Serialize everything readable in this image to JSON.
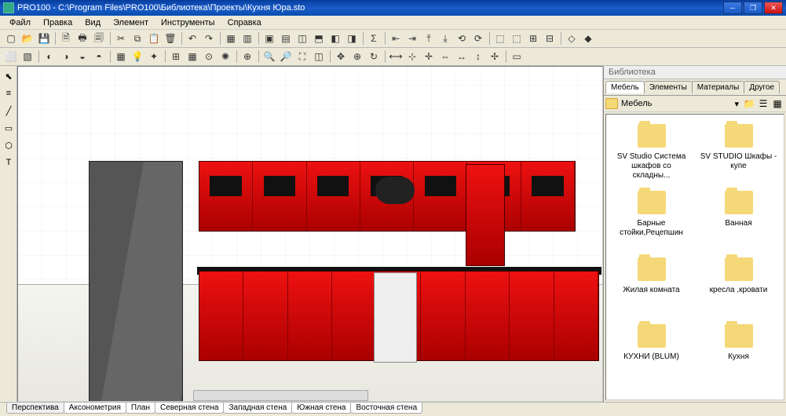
{
  "title": "PRO100 - C:\\Program Files\\PRO100\\Библиотека\\Проекты\\Кухня Юра.sto",
  "menu": [
    "Файл",
    "Правка",
    "Вид",
    "Элемент",
    "Инструменты",
    "Справка"
  ],
  "library": {
    "panel_title": "Библиотека",
    "tabs": [
      "Мебель",
      "Элементы",
      "Материалы",
      "Другое"
    ],
    "active_tab": 0,
    "path": "Мебель",
    "items": [
      "SV Studio  Система шкафов со складны...",
      "SV STUDIO  Шкафы - купе",
      "Барные стойки,Рецепшин",
      "Ванная",
      "Жилая комната",
      "кресла ,кровати",
      "КУХНИ (BLUM)",
      "Кухня"
    ]
  },
  "bottom_tabs": [
    "Перспектива",
    "Аксонометрия",
    "План",
    "Северная стена",
    "Западная стена",
    "Южная стена",
    "Восточная стена"
  ]
}
